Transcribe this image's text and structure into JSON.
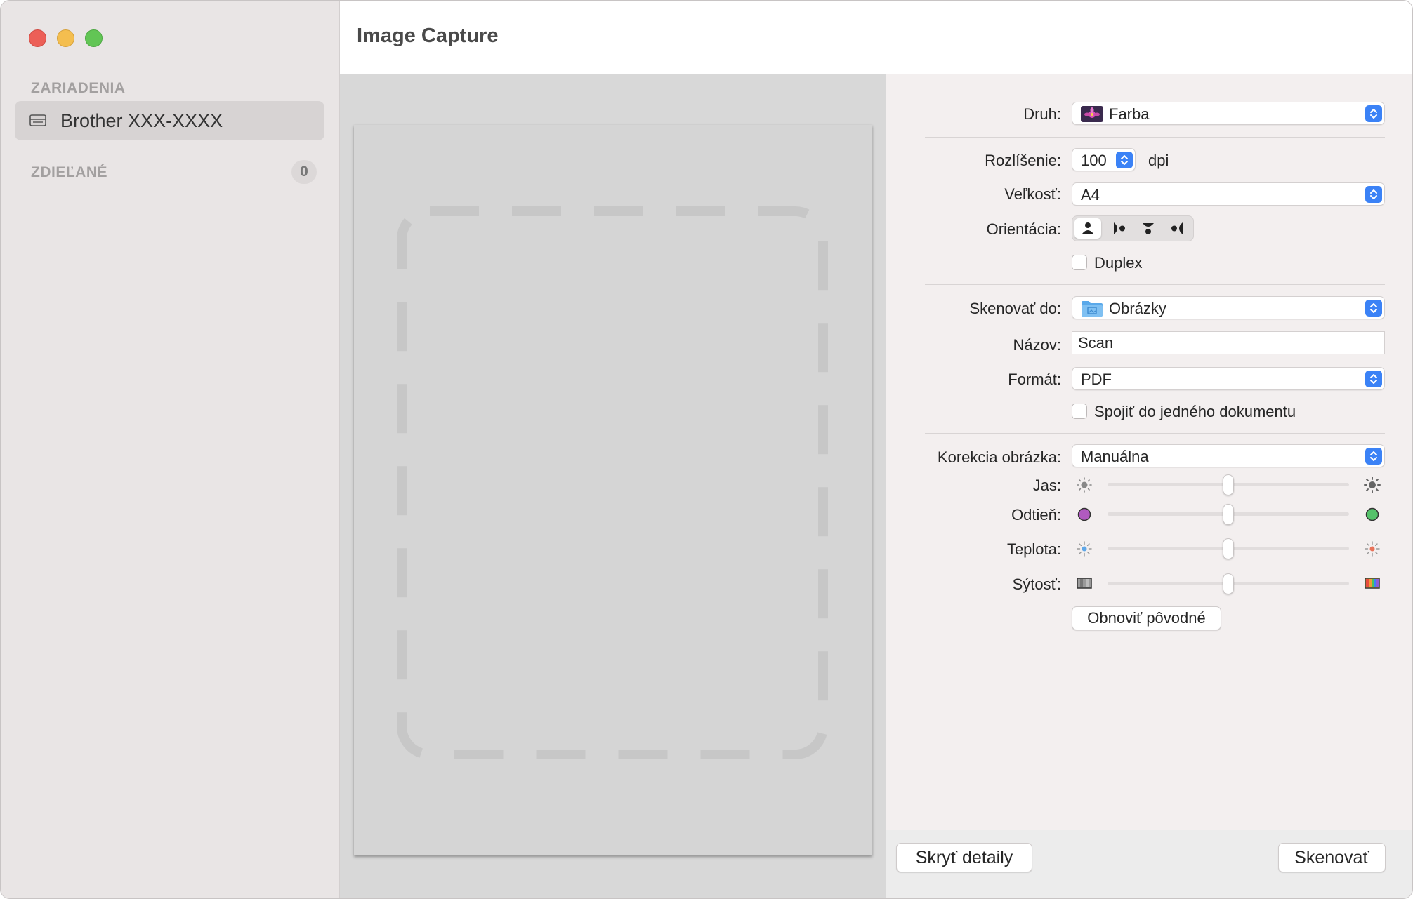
{
  "window": {
    "title": "Image Capture"
  },
  "sidebar": {
    "devices_heading": "ZARIADENIA",
    "devices": [
      {
        "label": "Brother XXX-XXXX",
        "icon": "scanner-icon"
      }
    ],
    "shared_heading": "ZDIEĽANÉ",
    "shared_count": "0"
  },
  "settings": {
    "kind": {
      "label": "Druh:",
      "value": "Farba",
      "icon": "color-photo-icon"
    },
    "resolution": {
      "label": "Rozlíšenie:",
      "value": "100",
      "unit": "dpi"
    },
    "size": {
      "label": "Veľkosť:",
      "value": "A4"
    },
    "orientation": {
      "label": "Orientácia:",
      "selected_index": 0
    },
    "duplex": {
      "label": "Duplex",
      "checked": false
    },
    "scan_to": {
      "label": "Skenovať do:",
      "value": "Obrázky",
      "icon": "pictures-folder-icon"
    },
    "name": {
      "label": "Názov:",
      "value": "Scan"
    },
    "format": {
      "label": "Formát:",
      "value": "PDF"
    },
    "combine": {
      "label": "Spojiť do jedného dokumentu",
      "checked": false
    },
    "image_correction": {
      "label": "Korekcia obrázka:",
      "value": "Manuálna"
    },
    "brightness": {
      "label": "Jas:",
      "level": 0.5
    },
    "tint": {
      "label": "Odtieň:",
      "level": 0.5,
      "min_color": "#b05ac0",
      "max_color": "#55c26a"
    },
    "temperature": {
      "label": "Teplota:",
      "level": 0.5
    },
    "saturation": {
      "label": "Sýtosť:",
      "level": 0.5
    },
    "restore_button": "Obnoviť pôvodné"
  },
  "footer": {
    "hide_details": "Skryť detaily",
    "scan": "Skenovať"
  },
  "colors": {
    "accent": "#3b82f6",
    "close": "#ec5f57",
    "minimize": "#f4be4f",
    "zoom": "#62c555"
  }
}
